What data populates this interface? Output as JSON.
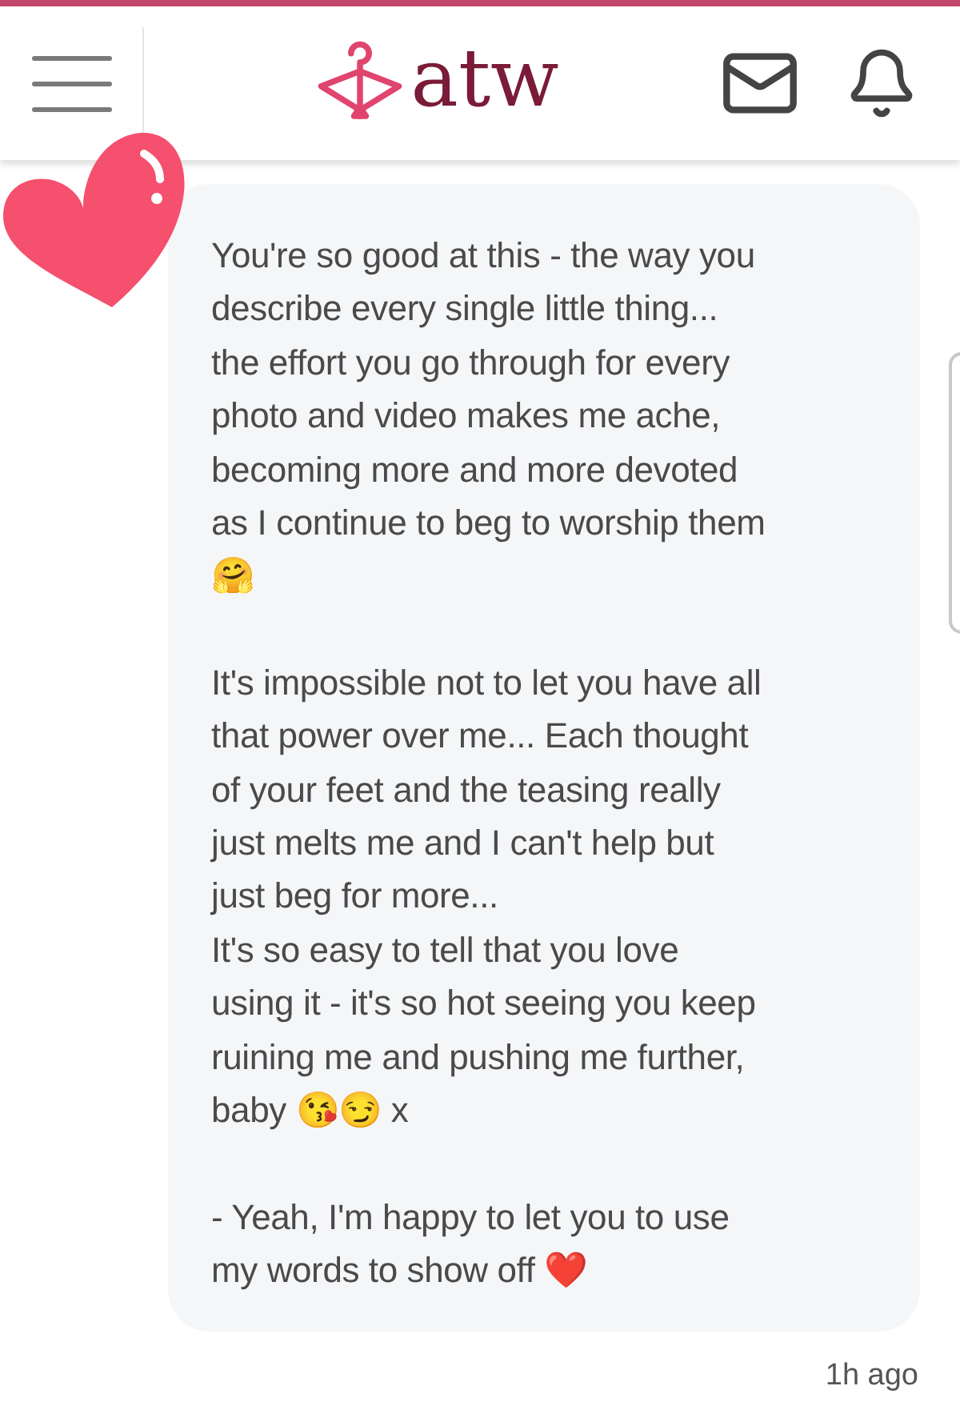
{
  "header": {
    "logo_text": "atw"
  },
  "message": {
    "paragraphs": [
      [
        "You're so good at this - the way you",
        "describe every single little thing...",
        "the effort you go through for every",
        "photo and video makes me ache,",
        "becoming more and more devoted",
        "as I continue to beg to worship them",
        "🤗"
      ],
      [
        "It's impossible not to let you have all",
        "that power over me... Each thought",
        "of your feet and the teasing really",
        "just melts me and I can't help but",
        "just beg for more...",
        "It's so easy to tell that you love",
        "using it - it's so hot seeing you keep",
        "ruining me and pushing me further,",
        "baby 😘😏 x"
      ],
      [
        "- Yeah, I'm happy to let you to use",
        "my words to show off ❤️"
      ]
    ],
    "time": "1h ago"
  }
}
